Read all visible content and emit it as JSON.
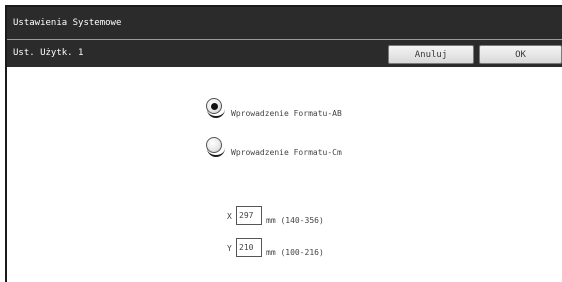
{
  "window": {
    "title": "Ustawienia Systemowe"
  },
  "subheader": {
    "title": "Ust. Użytk. 1",
    "cancel_label": "Anuluj",
    "ok_label": "OK"
  },
  "format_options": [
    {
      "label": "Wprowadzenie Formatu-AB",
      "selected": true
    },
    {
      "label": "Wprowadzenie Formatu-Cm",
      "selected": false
    }
  ],
  "dimensions": {
    "x": {
      "letter": "X",
      "value": "297",
      "range": "mm (140-356)"
    },
    "y": {
      "letter": "Y",
      "value": "210",
      "range": "mm (100-216)"
    }
  }
}
